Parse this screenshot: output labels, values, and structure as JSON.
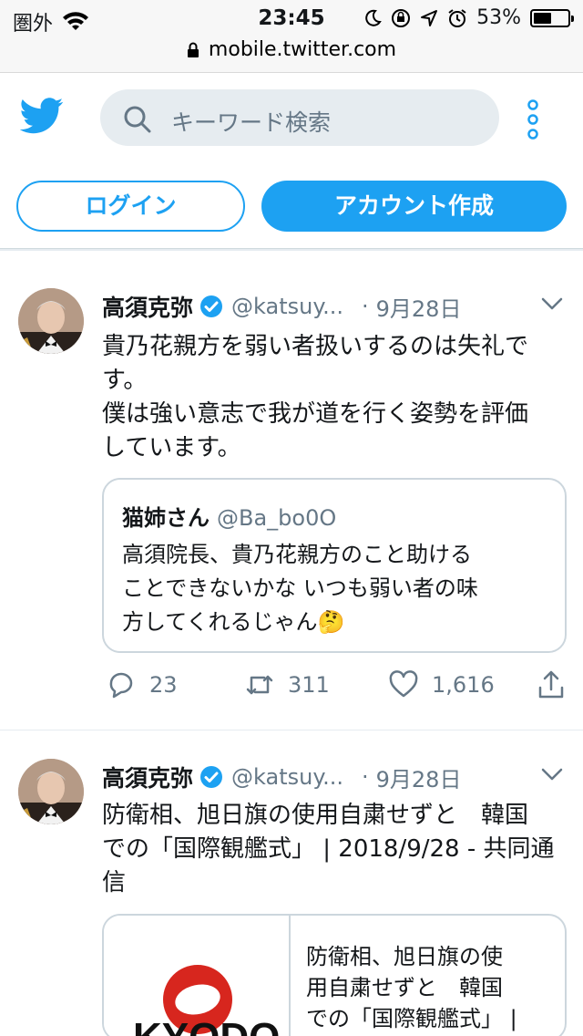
{
  "status_bar": {
    "carrier": "圏外",
    "time": "23:45",
    "battery": "53%",
    "battery_level": 0.53
  },
  "url_bar": {
    "url": "mobile.twitter.com"
  },
  "header": {
    "search_placeholder": "キーワード検索"
  },
  "auth": {
    "login_label": "ログイン",
    "signup_label": "アカウント作成"
  },
  "tweets": [
    {
      "name": "高須克弥",
      "handle": "@katsuy...",
      "dot": "·",
      "date": "9月28日",
      "text": "貴乃花親方を弱い者扱いするのは失礼で\nす。\n僕は強い意志で我が道を行く姿勢を評価\nしています。",
      "quote": {
        "name": "猫姉さん",
        "handle": "@Ba_bo0O",
        "text": "高須院長、貴乃花親方のこと助ける\nことできないかな いつも弱い者の味\n方してくれるじゃん🤔"
      },
      "replies": "23",
      "retweets": "311",
      "likes": "1,616"
    },
    {
      "name": "高須克弥",
      "handle": "@katsuy...",
      "dot": "·",
      "date": "9月28日",
      "text": "防衛相、旭日旗の使用自粛せずと　韓国\nでの「国際観艦式」 | 2018/9/28 - 共同通\n信",
      "card": {
        "text": "防衛相、旭日旗の使\n用自粛せずと　韓国\nでの「国際観艦式」 |",
        "logo_text": "KYODO"
      }
    }
  ],
  "colors": {
    "accent": "#1da1f2",
    "muted": "#657786",
    "border": "#ccd6dd"
  }
}
